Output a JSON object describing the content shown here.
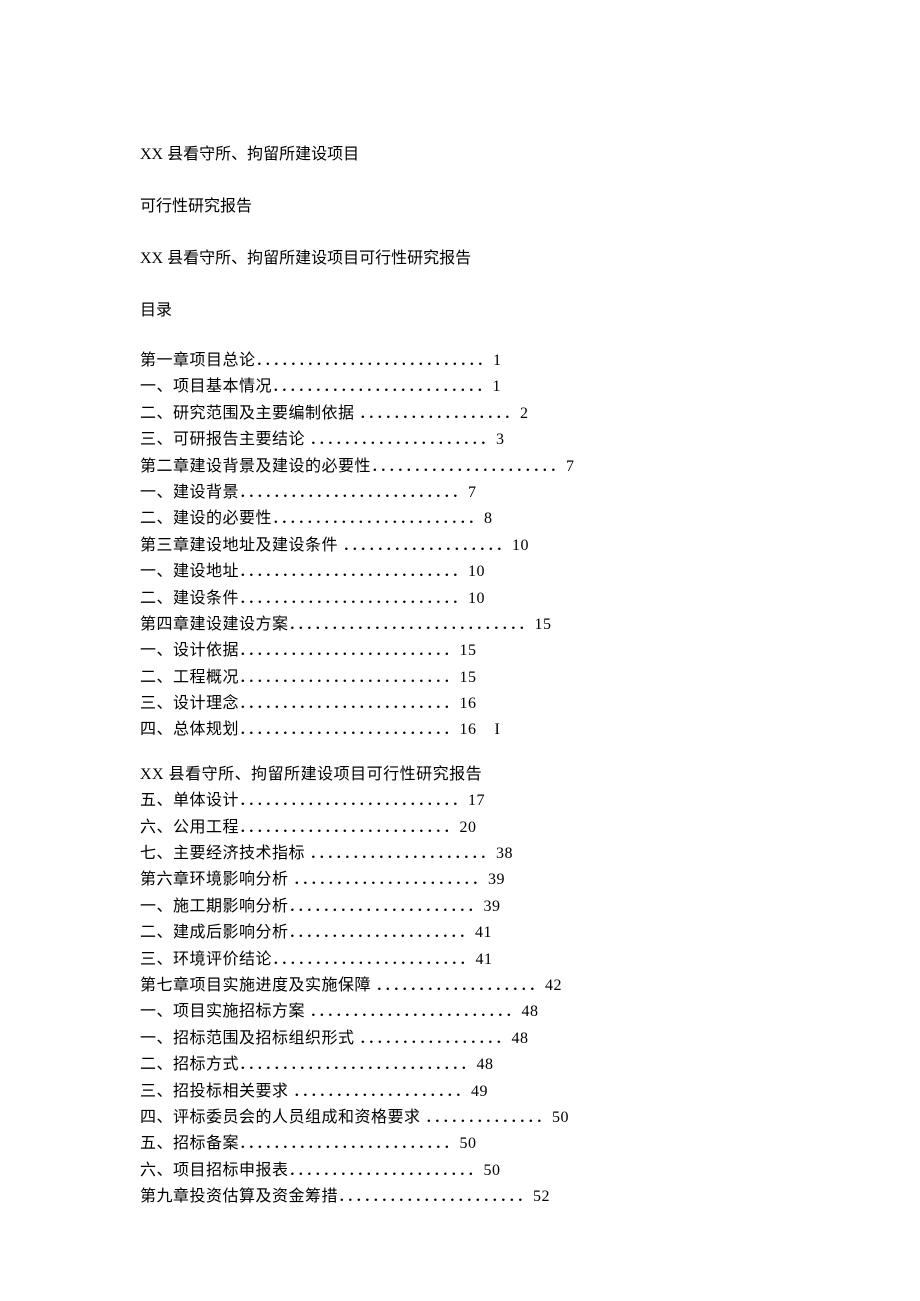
{
  "header": {
    "title1": "XX 县看守所、拘留所建设项目",
    "title2": "可行性研究报告",
    "title3": "XX 县看守所、拘留所建设项目可行性研究报告",
    "toc_label": "目录"
  },
  "toc_block1": [
    {
      "text": "第一章项目总论",
      "dots": "．．．．．．．．．．．．．．．．．．．．．．．．．．．",
      "page": "1"
    },
    {
      "text": "一、项目基本情况",
      "dots": "．．．．．．．．．．．．．．．．．．．．．．．．．",
      "page": "1"
    },
    {
      "text": "二、研究范围及主要编制依据 ",
      "dots": "．．．．．．．．．．．．．．．．．．",
      "page": "2"
    },
    {
      "text": "三、可研报告主要结论 ",
      "dots": "．．．．．．．．．．．．．．．．．．．．．",
      "page": "3"
    },
    {
      "text": "第二章建设背景及建设的必要性",
      "dots": "．．．．．．．．．．．．．．．．．．．．．．",
      "page": "7"
    },
    {
      "text": "一、建设背景",
      "dots": "．．．．．．．．．．．．．．．．．．．．．．．．．．",
      "page": "7"
    },
    {
      "text": "二、建设的必要性",
      "dots": "．．．．．．．．．．．．．．．．．．．．．．．．",
      "page": "8"
    },
    {
      "text": "第三章建设地址及建设条件 ",
      "dots": "．．．．．．．．．．．．．．．．．．．",
      "page": "10"
    },
    {
      "text": "一、建设地址",
      "dots": "．．．．．．．．．．．．．．．．．．．．．．．．．．",
      "page": "10"
    },
    {
      "text": "二、建设条件",
      "dots": "．．．．．．．．．．．．．．．．．．．．．．．．．．",
      "page": "10"
    },
    {
      "text": "第四章建设建设方案",
      "dots": "．．．．．．．．．．．．．．．．．．．．．．．．．．．．",
      "page": "15"
    },
    {
      "text": "一、设计依据",
      "dots": "．．．．．．．．．．．．．．．．．．．．．．．．．",
      "page": "15"
    },
    {
      "text": "二、工程概况",
      "dots": "．．．．．．．．．．．．．．．．．．．．．．．．．",
      "page": "15"
    },
    {
      "text": "三、设计理念",
      "dots": "．．．．．．．．．．．．．．．．．．．．．．．．．",
      "page": "16"
    },
    {
      "text": "四、总体规划",
      "dots": "．．．．．．．．．．．．．．．．．．．．．．．．．",
      "page": "16",
      "extra": "I"
    }
  ],
  "midline": "XX 县看守所、拘留所建设项目可行性研究报告",
  "toc_block2": [
    {
      "text": "五、单体设计",
      "dots": "．．．．．．．．．．．．．．．．．．．．．．．．．．",
      "page": "17"
    },
    {
      "text": "六、公用工程",
      "dots": "．．．．．．．．．．．．．．．．．．．．．．．．．",
      "page": "20"
    },
    {
      "text": "七、主要经济技术指标 ",
      "dots": "．．．．．．．．．．．．．．．．．．．．．",
      "page": "38"
    },
    {
      "text": "第六章环境影响分析 ",
      "dots": "．．．．．．．．．．．．．．．．．．．．．．",
      "page": "39"
    },
    {
      "text": "一、施工期影响分析",
      "dots": "．．．．．．．．．．．．．．．．．．．．．．",
      "page": "39"
    },
    {
      "text": "二、建成后影响分析",
      "dots": "．．．．．．．．．．．．．．．．．．．．．",
      "page": "41"
    },
    {
      "text": "三、环境评价结论",
      "dots": "．．．．．．．．．．．．．．．．．．．．．．．",
      "page": "41"
    },
    {
      "text": "第七章项目实施进度及实施保障 ",
      "dots": "．．．．．．．．．．．．．．．．．．．",
      "page": "42"
    },
    {
      "text": "一、项目实施招标方案 ",
      "dots": "．．．．．．．．．．．．．．．．．．．．．．．．",
      "page": "48"
    },
    {
      "text": "一、招标范围及招标组织形式 ",
      "dots": "．．．．．．．．．．．．．．．．．",
      "page": "48"
    },
    {
      "text": "二、招标方式",
      "dots": "．．．．．．．．．．．．．．．．．．．．．．．．．．．",
      "page": "48"
    },
    {
      "text": "三、招投标相关要求 ",
      "dots": "．．．．．．．．．．．．．．．．．．．．",
      "page": "49"
    },
    {
      "text": "四、评标委员会的人员组成和资格要求 ",
      "dots": "．．．．．．．．．．．．．．",
      "page": "50"
    },
    {
      "text": "五、招标备案",
      "dots": "．．．．．．．．．．．．．．．．．．．．．．．．．",
      "page": "50"
    },
    {
      "text": "六、项目招标申报表",
      "dots": "．．．．．．．．．．．．．．．．．．．．．．",
      "page": "50"
    },
    {
      "text": "第九章投资估算及资金筹措",
      "dots": "．．．．．．．．．．．．．．．．．．．．．．",
      "page": "52"
    }
  ]
}
